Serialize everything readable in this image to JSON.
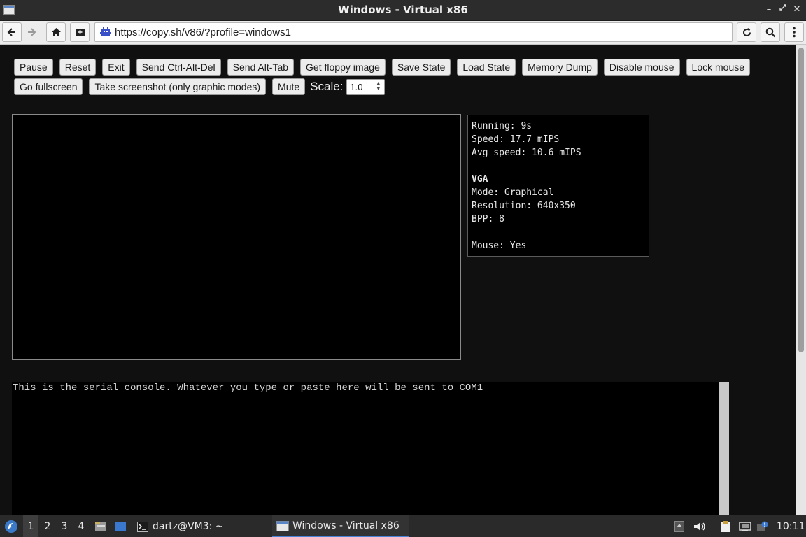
{
  "window": {
    "title": "Windows - Virtual x86"
  },
  "browser": {
    "url": "https://copy.sh/v86/?profile=windows1"
  },
  "controls": {
    "row1": [
      "Pause",
      "Reset",
      "Exit",
      "Send Ctrl-Alt-Del",
      "Send Alt-Tab",
      "Get floppy image",
      "Save State",
      "Load State",
      "Memory Dump",
      "Disable mouse",
      "Lock mouse"
    ],
    "row2": [
      "Go fullscreen",
      "Take screenshot (only graphic modes)",
      "Mute"
    ],
    "scale_label": "Scale:",
    "scale_value": "1.0"
  },
  "info": {
    "running": "Running: 9s",
    "speed": "Speed: 17.7 mIPS",
    "avg_speed": "Avg speed: 10.6 mIPS",
    "vga_heading": "VGA",
    "mode": "Mode: Graphical",
    "resolution": "Resolution: 640x350",
    "bpp": "BPP: 8",
    "mouse": "Mouse: Yes"
  },
  "serial": {
    "text": "This is the serial console. Whatever you type or paste here will be sent to COM1"
  },
  "taskbar": {
    "workspaces": [
      "1",
      "2",
      "3",
      "4"
    ],
    "terminal_task": "dartz@VM3: ~",
    "browser_task": "Windows - Virtual x86",
    "clock": "10:11"
  },
  "colors": {
    "page_bg": "#101010",
    "accent": "#4a82d8"
  }
}
